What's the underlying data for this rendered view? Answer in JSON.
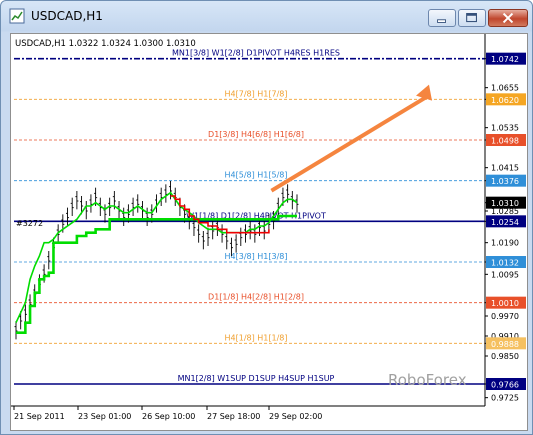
{
  "window": {
    "title": "USDCAD,H1",
    "icon": "chart-window-icon",
    "buttons": [
      {
        "name": "minimize-button",
        "icon": "minimize-icon"
      },
      {
        "name": "maximize-button",
        "icon": "maximize-icon"
      },
      {
        "name": "close-button",
        "icon": "close-icon"
      }
    ]
  },
  "chart": {
    "header": "USDCAD,H1  1.0322 1.0324 1.0300 1.0310",
    "watermark": "RoboForex",
    "grid_label": "#3272",
    "colors": {
      "price_bars": "#000000",
      "fast_line": "#00dd00",
      "slow_line": "#00dd00",
      "red_line": "#ee0000",
      "arrow": "#f5853f",
      "navy": "#000080"
    }
  },
  "chart_data": {
    "type": "line",
    "y_range": [
      0.97,
      1.081
    ],
    "x_ticks": [
      "21 Sep 2011",
      "23 Sep 01:00",
      "26 Sep 10:00",
      "27 Sep 18:00",
      "29 Sep 02:00"
    ],
    "y_ticks": [
      "1.0742",
      "1.0655",
      "1.0620",
      "1.0535",
      "1.0498",
      "1.0415",
      "1.0376",
      "1.0310",
      "1.0285",
      "1.0254",
      "1.0190",
      "1.0132",
      "1.0095",
      "1.0010",
      "0.9970",
      "0.9910",
      "0.9888",
      "0.9850",
      "0.9766",
      "0.9725"
    ],
    "levels": [
      {
        "value": 1.0742,
        "label": "MN1[3/8] W1[2/8] D1PIVOT H4RES H1RES",
        "tag": "1.0742",
        "color": "#000080",
        "style": "dashdot",
        "tag_bg": "#000080"
      },
      {
        "value": 1.062,
        "label": "H4[7/8] H1[7/8]",
        "tag": "1.0620",
        "color": "#f0a030",
        "style": "dashed",
        "tag_bg": "#f5a623"
      },
      {
        "value": 1.0498,
        "label": "D1[3/8] H4[6/8] H1[6/8]",
        "tag": "1.0498",
        "color": "#e8502a",
        "style": "dashed",
        "tag_bg": "#e8502a"
      },
      {
        "value": 1.0376,
        "label": "H4[5/8] H1[5/8]",
        "tag": "1.0376",
        "color": "#2f8fd8",
        "style": "dashed",
        "tag_bg": "#2f8fd8"
      },
      {
        "value": 1.0254,
        "label": "W1[1/8] D1[2/8] H4PIVOT H1PIVOT",
        "tag": "1.0254",
        "color": "#000080",
        "style": "solid",
        "tag_bg": "#000080"
      },
      {
        "value": 1.0132,
        "label": "H4[3/8] H1[3/8]",
        "tag": "1.0132",
        "color": "#2f8fd8",
        "style": "dashed",
        "tag_bg": "#2f8fd8"
      },
      {
        "value": 1.001,
        "label": "D1[1/8] H4[2/8] H1[2/8]",
        "tag": "1.0010",
        "color": "#e8502a",
        "style": "dashed",
        "tag_bg": "#e8502a"
      },
      {
        "value": 0.9888,
        "label": "H4[1/8] H1[1/8]",
        "tag": "0.9888",
        "color": "#f0a030",
        "style": "dashed",
        "tag_bg": "#f5c060"
      },
      {
        "value": 0.9766,
        "label": "MN1[2/8] W1SUP D1SUP H4SUP H1SUP",
        "tag": "0.9766",
        "color": "#000080",
        "style": "solid",
        "tag_bg": "#000080"
      }
    ],
    "current_price": {
      "value": 1.031,
      "tag": "1.0310"
    },
    "price_series": [
      0.993,
      0.996,
      0.998,
      1.001,
      1.004,
      1.007,
      1.01,
      1.014,
      1.018,
      1.022,
      1.025,
      1.027,
      1.03,
      1.032,
      1.0305,
      1.029,
      1.031,
      1.033,
      1.03,
      1.028,
      1.03,
      1.032,
      1.029,
      1.027,
      1.028,
      1.03,
      1.031,
      1.029,
      1.027,
      1.028,
      1.031,
      1.033,
      1.034,
      1.035,
      1.033,
      1.03,
      1.028,
      1.026,
      1.024,
      1.022,
      1.02,
      1.021,
      1.023,
      1.024,
      1.022,
      1.02,
      1.018,
      1.019,
      1.021,
      1.022,
      1.023,
      1.022,
      1.024,
      1.023,
      1.025,
      1.026,
      1.03,
      1.033,
      1.034,
      1.032,
      1.031
    ],
    "fast_line": [
      0.992,
      0.992,
      0.995,
      1.0,
      1.004,
      1.008,
      1.009,
      1.01,
      1.019,
      1.019,
      1.019,
      1.019,
      1.019,
      1.021,
      1.021,
      1.022,
      1.022,
      1.023,
      1.023,
      1.023,
      1.026,
      1.026,
      1.026,
      1.026,
      1.026,
      1.026,
      1.026,
      1.026,
      1.026,
      1.026,
      1.026,
      1.026,
      1.026,
      1.026,
      1.026,
      1.026,
      1.026,
      1.026,
      1.026,
      1.026,
      1.026,
      1.026,
      1.026,
      1.026,
      1.026,
      1.026,
      1.026,
      1.026,
      1.026,
      1.026,
      1.026,
      1.026,
      1.026,
      1.026,
      1.026,
      1.026,
      1.027,
      1.027,
      1.027,
      1.027,
      1.027
    ],
    "slow_line": [
      0.995,
      0.998,
      1.001,
      1.008,
      1.012,
      1.015,
      1.019,
      1.019,
      1.02,
      1.022,
      1.023,
      1.024,
      1.025,
      1.026,
      1.028,
      1.03,
      1.03,
      1.031,
      1.03,
      1.029,
      1.03,
      1.03,
      1.029,
      1.028,
      1.028,
      1.029,
      1.03,
      1.029,
      1.028,
      1.028,
      1.03,
      1.032,
      1.033,
      1.034,
      1.032,
      1.03,
      1.029,
      1.028,
      1.027,
      1.025,
      1.024,
      1.023,
      1.023,
      1.023,
      1.022,
      1.022,
      1.022,
      1.022,
      1.022,
      1.022,
      1.023,
      1.023,
      1.024,
      1.024,
      1.025,
      1.027,
      1.029,
      1.031,
      1.032,
      1.032,
      1.031
    ],
    "red_line": [
      null,
      null,
      null,
      null,
      null,
      null,
      null,
      null,
      null,
      null,
      null,
      null,
      null,
      null,
      null,
      null,
      null,
      null,
      null,
      null,
      null,
      null,
      null,
      null,
      null,
      null,
      null,
      null,
      null,
      null,
      null,
      null,
      null,
      1.033,
      1.032,
      1.03,
      1.029,
      1.027,
      1.026,
      1.025,
      1.025,
      1.024,
      1.024,
      1.023,
      1.023,
      1.022,
      1.022,
      1.022,
      1.022,
      1.022,
      1.022,
      1.022,
      1.022,
      1.022,
      1.023,
      null,
      null,
      null,
      null,
      null,
      null
    ],
    "arrow": {
      "from": [
        46,
        1.034
      ],
      "to": [
        60,
        1.07
      ]
    }
  }
}
